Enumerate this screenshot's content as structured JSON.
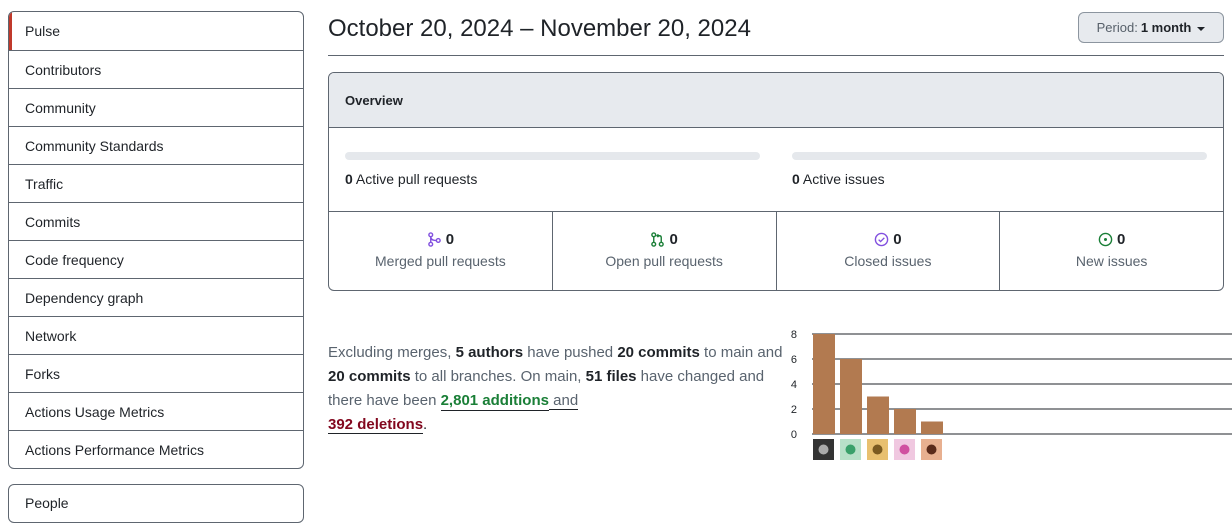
{
  "sidebar": {
    "items": [
      {
        "label": "Pulse"
      },
      {
        "label": "Contributors"
      },
      {
        "label": "Community"
      },
      {
        "label": "Community Standards"
      },
      {
        "label": "Traffic"
      },
      {
        "label": "Commits"
      },
      {
        "label": "Code frequency"
      },
      {
        "label": "Dependency graph"
      },
      {
        "label": "Network"
      },
      {
        "label": "Forks"
      },
      {
        "label": "Actions Usage Metrics"
      },
      {
        "label": "Actions Performance Metrics"
      }
    ],
    "people_label": "People",
    "selected_color": "#c0392b"
  },
  "header": {
    "date_range": "October 20, 2024 – November 20, 2024",
    "period_prefix": "Period:",
    "period_value": "1 month"
  },
  "overview": {
    "title": "Overview",
    "active_prs_count": "0",
    "active_prs_label": "Active pull requests",
    "active_issues_count": "0",
    "active_issues_label": "Active issues",
    "stats": [
      {
        "count": "0",
        "label": "Merged pull requests",
        "icon": "merge-icon",
        "color": "#8250df"
      },
      {
        "count": "0",
        "label": "Open pull requests",
        "icon": "pull-request-icon",
        "color": "#1a7f37"
      },
      {
        "count": "0",
        "label": "Closed issues",
        "icon": "issue-closed-icon",
        "color": "#8250df"
      },
      {
        "count": "0",
        "label": "New issues",
        "icon": "issue-opened-icon",
        "color": "#1a7f37"
      }
    ]
  },
  "summary": {
    "t1": "Excluding merges, ",
    "authors": "5 authors",
    "t2": " have pushed ",
    "commits_main": "20 commits",
    "t3": " to main and ",
    "commits_all": "20 commits",
    "t4": " to all branches. On main, ",
    "files": "51 files",
    "t5": " have changed and there have been ",
    "additions": "2,801 additions",
    "t6": " and",
    "deletions": "392 deletions",
    "t7": "."
  },
  "chart_data": {
    "type": "bar",
    "categories": [
      "author-1",
      "author-2",
      "author-3",
      "author-4",
      "author-5"
    ],
    "values": [
      8,
      6,
      3,
      2,
      1
    ],
    "ylim": [
      0,
      8
    ],
    "yticks": [
      "0",
      "2",
      "4",
      "6",
      "8"
    ],
    "bar_color": "#b27a50",
    "grid": true
  }
}
